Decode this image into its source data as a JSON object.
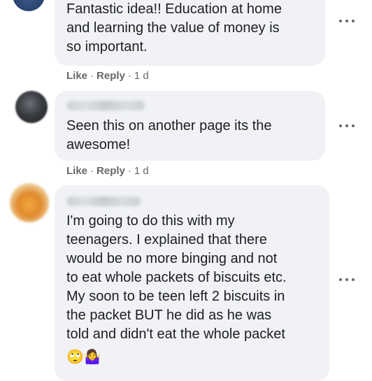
{
  "comments": [
    {
      "text": "Fantastic idea!! Education at home\nand learning the value of money is\nso important.",
      "actions": {
        "like": "Like",
        "dot": "·",
        "reply": "Reply",
        "time_dot": "·",
        "time": "1 d"
      }
    },
    {
      "text": "Seen this on another page its the\nawesome!",
      "actions": {
        "like": "Like",
        "dot": "·",
        "reply": "Reply",
        "time_dot": "·",
        "time": "1 d"
      }
    },
    {
      "text": "I'm going to do this with my\nteenagers. I explained that there\nwould be no more binging and not\nto eat whole packets of biscuits etc.\nMy soon to be teen left 2 biscuits in\nthe packet BUT he did as he was\ntold and didn't eat the whole packet",
      "emojis": "🙄🤷‍♀️"
    }
  ],
  "icons": {
    "more": "more-options-icon"
  },
  "colors": {
    "bubble": "#f0f2f5",
    "text": "#1c1e21",
    "meta": "#65676b"
  }
}
